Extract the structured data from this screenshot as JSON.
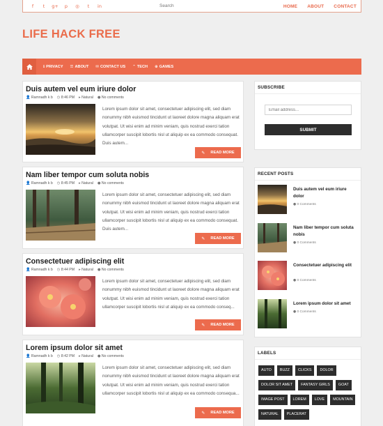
{
  "topbar": {
    "social_icons": [
      "f",
      "t",
      "g+",
      "p",
      "◎",
      "t",
      "in"
    ],
    "social_names": [
      "facebook-icon",
      "twitter-icon",
      "google-plus-icon",
      "pinterest-icon",
      "instagram-icon",
      "tumblr-icon",
      "linkedin-icon"
    ],
    "search_placeholder": "Search",
    "nav": [
      "HOME",
      "ABOUT",
      "CONTACT"
    ]
  },
  "brand": {
    "title": "LIFE HACK FREE",
    "color": "#ea6c4b"
  },
  "mainnav": {
    "home_icon": "home-icon",
    "items": [
      {
        "icon": "ℹ",
        "label": "PRIVACY"
      },
      {
        "icon": "☰",
        "label": "ABOUT"
      },
      {
        "icon": "✉",
        "label": "CONTACT US"
      },
      {
        "icon": "⌃",
        "label": "TECH"
      },
      {
        "icon": "⊕",
        "label": "GAMES"
      }
    ]
  },
  "posts": [
    {
      "title": "Duis autem vel eum iriure dolor",
      "author": "Ramnadh k b",
      "time": "8:46 PM",
      "label": "Natural",
      "comments": "No comments",
      "excerpt": "Lorem ipsum dolor sit amet, consectetuer adipiscing elit, sed diam nonummy nibh euismod tincidunt ut laoreet dolore magna aliquam erat volutpat. Ut wisi enim ad minim veniam, quis nostrud exerci tation ullamcorper suscipit lobortis nisl ut aliquip ex ea commodo consequat. Duis autem...",
      "read_more": "READ MORE",
      "image": "sunset"
    },
    {
      "title": "Nam liber tempor cum soluta nobis",
      "author": "Ramnadh k b",
      "time": "8:45 PM",
      "label": "Natural",
      "comments": "No comments",
      "excerpt": "Lorem ipsum dolor sit amet, consectetuer adipiscing elit, sed diam nonummy nibh euismod tincidunt ut laoreet dolore magna aliquam erat volutpat. Ut wisi enim ad minim veniam, quis nostrud exerci tation ullamcorper suscipit lobortis nisl ut aliquip ex ea commodo consequat. Duis autem...",
      "read_more": "READ MORE",
      "image": "forest"
    },
    {
      "title": "Consectetuer adipiscing elit",
      "author": "Ramnadh k b",
      "time": "8:44 PM",
      "label": "Natural",
      "comments": "No comments",
      "excerpt": "Lorem ipsum dolor sit amet, consectetuer adipiscing elit, sed diam nonummy nibh euismod tincidunt ut laoreet dolore magna aliquam erat volutpat. Ut wisi enim ad minim veniam, quis nostrud exerci tation ullamcorper suscipit lobortis nisl ut aliquip ex ea commodo conseq...",
      "read_more": "READ MORE",
      "image": "flower"
    },
    {
      "title": "Lorem ipsum dolor sit amet",
      "author": "Ramnadh k b",
      "time": "8:42 PM",
      "label": "Natural",
      "comments": "No comments",
      "excerpt": "Lorem ipsum dolor sit amet, consectetuer adipiscing elit, sed diam nonummy nibh euismod tincidunt ut laoreet dolore magna aliquam erat volutpat. Ut wisi enim ad minim veniam, quis nostrud exerci tation ullamcorper suscipit lobortis nisl ut aliquip ex ea commodo consequa...",
      "read_more": "READ MORE",
      "image": "woods"
    }
  ],
  "subscribe": {
    "title": "SUBSCRIBE",
    "email_placeholder": "Email address...",
    "button": "SUBMIT"
  },
  "recent": {
    "title": "RECENT POSTS",
    "items": [
      {
        "title": "Duis autem vel eum iriure dolor",
        "comments": "0 Comments",
        "image": "sunset"
      },
      {
        "title": "Nam liber tempor cum soluta nobis",
        "comments": "0 Comments",
        "image": "forest"
      },
      {
        "title": "Consectetuer adipiscing elit",
        "comments": "0 Comments",
        "image": "flower"
      },
      {
        "title": "Lorem ipsum dolor sit amet",
        "comments": "0 Comments",
        "image": "woods"
      }
    ]
  },
  "labels": {
    "title": "LABELS",
    "items": [
      "AUTO",
      "BUZZ",
      "CLICKS",
      "DOLOR",
      "DOLOR SIT AMET",
      "FANTASY GIRLS",
      "GOAT",
      "IMAGE POST",
      "LOREM",
      "LOVE",
      "MOUNTAIN",
      "NATURAL",
      "PLACERAT"
    ]
  },
  "colors": {
    "accent": "#ec6b4d",
    "dark": "#2d2d2d",
    "background": "#efefef"
  }
}
